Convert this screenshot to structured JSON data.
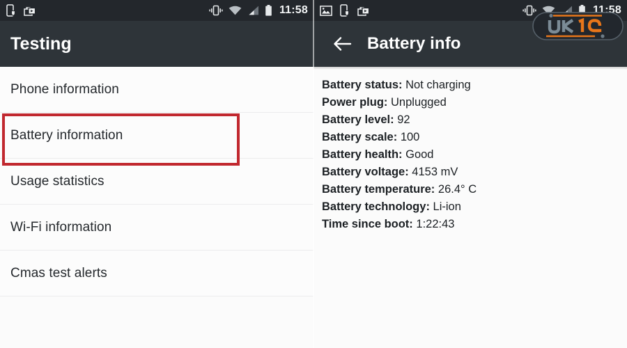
{
  "left_panel": {
    "status_bar": {
      "icons": [
        "phone-shield-icon",
        "camera-bag-icon"
      ],
      "right_icons": [
        "vibrate-icon",
        "wifi-icon",
        "signal-icon",
        "battery-icon"
      ],
      "clock": "11:58"
    },
    "app_bar": {
      "title": "Testing"
    },
    "list_items": [
      {
        "label": "Phone information"
      },
      {
        "label": "Battery information"
      },
      {
        "label": "Usage statistics"
      },
      {
        "label": "Wi-Fi information"
      },
      {
        "label": "Cmas test alerts"
      }
    ],
    "highlighted_item_index": 1,
    "highlight_color": "#c1282f"
  },
  "right_panel": {
    "status_bar": {
      "icons": [
        "image-icon",
        "phone-shield-icon",
        "camera-bag-icon"
      ],
      "right_icons": [
        "vibrate-icon",
        "wifi-icon",
        "signal-icon",
        "battery-icon"
      ],
      "clock": "11:58"
    },
    "app_bar": {
      "back_icon": "arrow-left-icon",
      "title": "Battery info"
    },
    "info_rows": [
      {
        "label": "Battery status:",
        "value": "Not charging"
      },
      {
        "label": "Power plug:",
        "value": "Unplugged"
      },
      {
        "label": "Battery level:",
        "value": "92"
      },
      {
        "label": "Battery scale:",
        "value": "100"
      },
      {
        "label": "Battery health:",
        "value": "Good"
      },
      {
        "label": "Battery voltage:",
        "value": "4153 mV"
      },
      {
        "label": "Battery temperature:",
        "value": " 26.4° C"
      },
      {
        "label": "Battery technology:",
        "value": "Li-ion"
      },
      {
        "label": "Time since boot:",
        "value": "1:22:43"
      }
    ]
  },
  "watermark": {
    "text_primary": "UK",
    "text_secondary": "19",
    "primary_color": "#7b8b96",
    "secondary_color": "#e8761a",
    "background_color": "#22272d"
  },
  "colors": {
    "status_bar": "#23272c",
    "app_bar": "#2e3439",
    "list_background": "#fcfcfc",
    "divider": "#ececed",
    "text_dark": "#24282c",
    "text_light": "#ffffff"
  }
}
